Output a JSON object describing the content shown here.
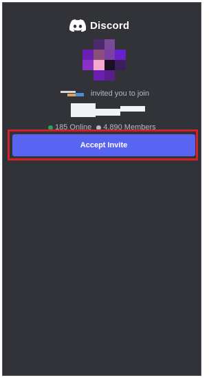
{
  "brand": {
    "name": "Discord",
    "logo_icon": "discord-logo-icon"
  },
  "invite": {
    "text": "invited you to join"
  },
  "stats": {
    "online": "185 Online",
    "members": "4,890 Members",
    "online_color": "#23a55a",
    "members_color": "#b5bac1"
  },
  "actions": {
    "accept_label": "Accept Invite"
  },
  "colors": {
    "background": "#313338",
    "accent": "#5865f2",
    "highlight_outline": "#d42027"
  },
  "server_icon_pixels": [
    "#313338",
    "#4b2a6b",
    "#7a4a9a",
    "#313338",
    "#6a1fb0",
    "#8a4f7a",
    "#7a3fa0",
    "#6a1fcc",
    "#8a32c8",
    "#f4a8cf",
    "#1a1024",
    "#3b1f5a",
    "#313338",
    "#6a1fb0",
    "#5a1d8a",
    "#313338"
  ]
}
